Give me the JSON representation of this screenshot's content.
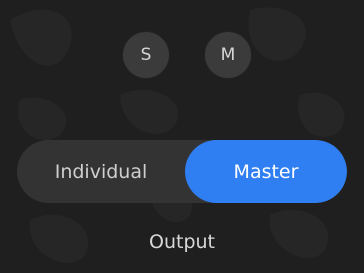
{
  "buttons": {
    "solo_label": "S",
    "mute_label": "M"
  },
  "mode_switch": {
    "options": [
      "Individual",
      "Master"
    ],
    "selected": "Master"
  },
  "footer": {
    "label": "Output"
  },
  "colors": {
    "background": "#1f1f1f",
    "button": "#3b3b3b",
    "segment_bg": "#333333",
    "accent": "#2f7ff2",
    "text": "#d6d6d6"
  }
}
